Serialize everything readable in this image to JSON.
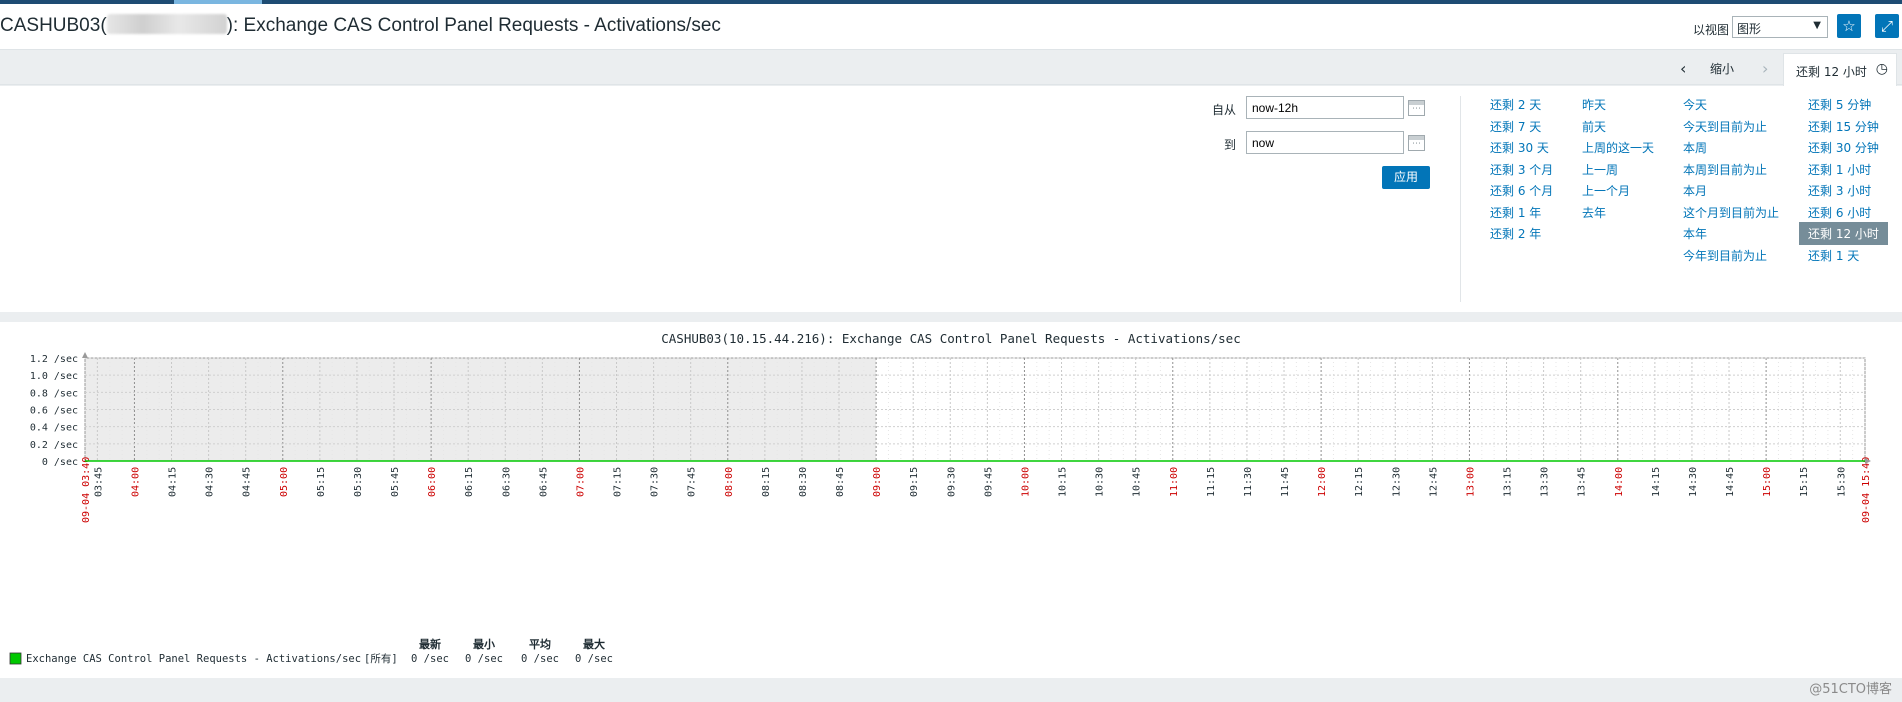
{
  "header": {
    "title_prefix": "CASHUB03(",
    "title_suffix": "): Exchange CAS Control Panel Requests - Activations/sec",
    "view_label": "以视图",
    "view_select": "图形"
  },
  "timebar": {
    "zoom_label": "缩小",
    "active_tab": "还剩 12 小时"
  },
  "filter": {
    "from_label": "自从",
    "from_value": "now-12h",
    "to_label": "到",
    "to_value": "now",
    "apply_label": "应用",
    "quick_columns": [
      [
        "还剩 2 天",
        "还剩 7 天",
        "还剩 30 天",
        "还剩 3 个月",
        "还剩 6 个月",
        "还剩 1 年",
        "还剩 2 年"
      ],
      [
        "昨天",
        "前天",
        "上周的这一天",
        "上一周",
        "上一个月",
        "去年"
      ],
      [
        "今天",
        "今天到目前为止",
        "本周",
        "本周到目前为止",
        "本月",
        "这个月到目前为止",
        "本年",
        "今年到目前为止"
      ],
      [
        "还剩 5 分钟",
        "还剩 15 分钟",
        "还剩 30 分钟",
        "还剩 1 小时",
        "还剩 3 小时",
        "还剩 6 小时",
        "还剩 12 小时",
        "还剩 1 天"
      ]
    ],
    "active_quick": "还剩 12 小时"
  },
  "graph": {
    "title": "CASHUB03(10.15.44.216): Exchange CAS Control Panel Requests - Activations/sec",
    "y_ticks": [
      "1.2 /sec",
      "1.0 /sec",
      "0.8 /sec",
      "0.6 /sec",
      "0.4 /sec",
      "0.2 /sec",
      "0 /sec"
    ],
    "x_start_label": "09-04 03:40",
    "x_end_label": "09-04 15:40",
    "x_ticks": [
      "03:45",
      "04:00",
      "04:15",
      "04:30",
      "04:45",
      "05:00",
      "05:15",
      "05:30",
      "05:45",
      "06:00",
      "06:15",
      "06:30",
      "06:45",
      "07:00",
      "07:15",
      "07:30",
      "07:45",
      "08:00",
      "08:15",
      "08:30",
      "08:45",
      "09:00",
      "09:15",
      "09:30",
      "09:45",
      "10:00",
      "10:15",
      "10:30",
      "10:45",
      "11:00",
      "11:15",
      "11:30",
      "11:45",
      "12:00",
      "12:15",
      "12:30",
      "12:45",
      "13:00",
      "13:15",
      "13:30",
      "13:45",
      "14:00",
      "14:15",
      "14:30",
      "14:45",
      "15:00",
      "15:15",
      "15:30"
    ],
    "legend": {
      "headers": [
        "最新",
        "最小",
        "平均",
        "最大"
      ],
      "item_name": "Exchange CAS Control Panel Requests - Activations/sec",
      "item_scope": "[所有]",
      "item_values": [
        "0 /sec",
        "0 /sec",
        "0 /sec",
        "0 /sec"
      ],
      "item_color": "#00c800"
    },
    "colors": {
      "hour_label": "#cc0000",
      "minute_label": "#1f2c33",
      "nodata_shade": "#ececec",
      "series": "#00c800"
    }
  },
  "chart_data": {
    "type": "line",
    "title": "CASHUB03(10.15.44.216): Exchange CAS Control Panel Requests - Activations/sec",
    "ylim": [
      0,
      1.2
    ],
    "xlim": [
      "09-04 03:40",
      "09-04 15:40"
    ],
    "grid": true,
    "series": [
      {
        "name": "Exchange CAS Control Panel Requests - Activations/sec",
        "x": [
          "09-04 03:40",
          "09-04 15:40"
        ],
        "values": [
          0,
          0
        ]
      }
    ]
  },
  "watermark": "@51CTO博客"
}
